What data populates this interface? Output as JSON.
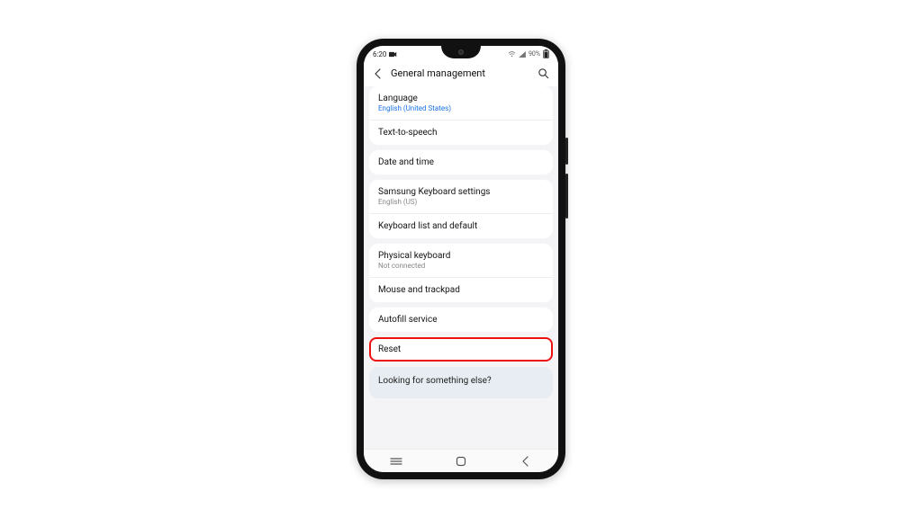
{
  "status": {
    "time": "6:20",
    "battery_text": "90%"
  },
  "header": {
    "title": "General management"
  },
  "groups": [
    {
      "rows": [
        {
          "title": "Language",
          "subtitle": "English (United States)",
          "subtitle_accent": true
        },
        {
          "title": "Text-to-speech"
        }
      ]
    },
    {
      "rows": [
        {
          "title": "Date and time"
        }
      ]
    },
    {
      "rows": [
        {
          "title": "Samsung Keyboard settings",
          "subtitle": "English (US)"
        },
        {
          "title": "Keyboard list and default"
        }
      ]
    },
    {
      "rows": [
        {
          "title": "Physical keyboard",
          "subtitle": "Not connected"
        },
        {
          "title": "Mouse and trackpad"
        }
      ]
    },
    {
      "rows": [
        {
          "title": "Autofill service"
        }
      ]
    },
    {
      "rows": [
        {
          "title": "Reset",
          "highlight": true
        }
      ]
    }
  ],
  "footer": {
    "prompt": "Looking for something else?"
  }
}
